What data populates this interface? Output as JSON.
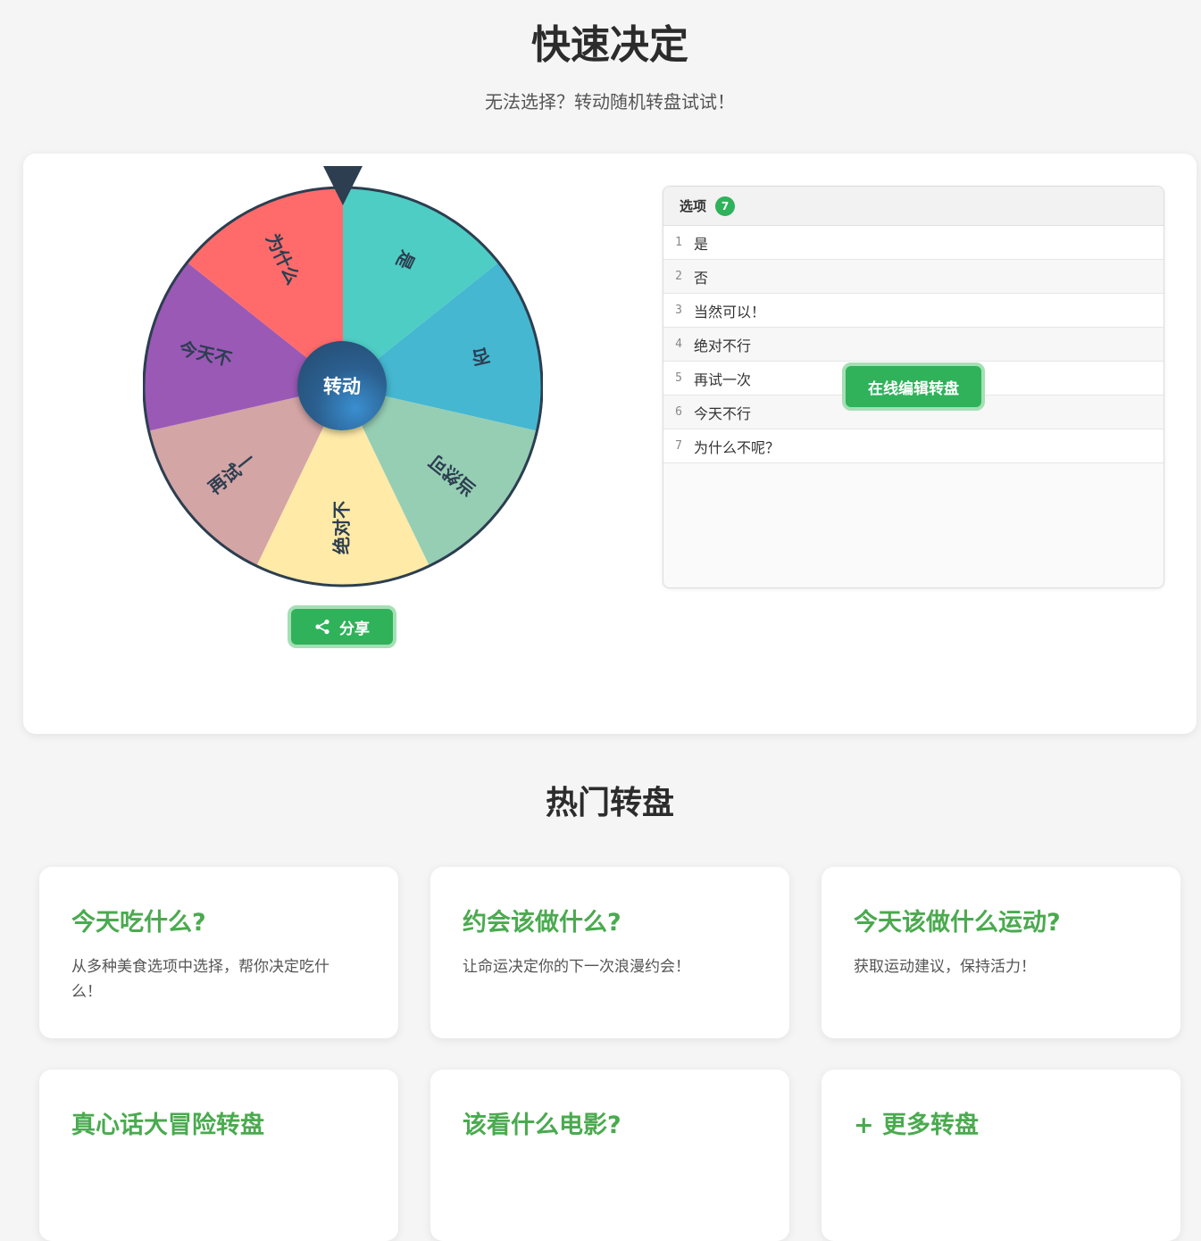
{
  "header": {
    "title": "快速决定",
    "subtitle": "无法选择？转动随机转盘试试！"
  },
  "wheel": {
    "spin_label": "转动",
    "share_label": "分享",
    "segments": [
      {
        "label": "是",
        "color": "#4ecdc4"
      },
      {
        "label": "否",
        "color": "#45b7d1"
      },
      {
        "label": "当然可",
        "color": "#96ceb4"
      },
      {
        "label": "绝对不",
        "color": "#ffeaa7"
      },
      {
        "label": "再试一",
        "color": "#d4a5a5"
      },
      {
        "label": "今天不",
        "color": "#9b59b6"
      },
      {
        "label": "为什么",
        "color": "#ff6b6b"
      }
    ]
  },
  "options": {
    "header_label": "选项",
    "count": "7",
    "items": [
      {
        "num": "1",
        "text": "是"
      },
      {
        "num": "2",
        "text": "否"
      },
      {
        "num": "3",
        "text": "当然可以！"
      },
      {
        "num": "4",
        "text": "绝对不行"
      },
      {
        "num": "5",
        "text": "再试一次"
      },
      {
        "num": "6",
        "text": "今天不行"
      },
      {
        "num": "7",
        "text": "为什么不呢？"
      }
    ],
    "edit_label": "在线编辑转盘"
  },
  "popular": {
    "title": "热门转盘",
    "cards": [
      {
        "title": "今天吃什么?",
        "desc": "从多种美食选项中选择，帮你决定吃什么！"
      },
      {
        "title": "约会该做什么?",
        "desc": "让命运决定你的下一次浪漫约会！"
      },
      {
        "title": "今天该做什么运动?",
        "desc": "获取运动建议，保持活力！"
      },
      {
        "title": "真心话大冒险转盘",
        "desc": ""
      },
      {
        "title": "该看什么电影?",
        "desc": ""
      },
      {
        "title": "+ 更多转盘",
        "desc": ""
      }
    ]
  },
  "theme": {
    "accent": "#2fb25a",
    "card_title_color": "#4aaa4f",
    "wheel_border": "#2c3e50"
  }
}
